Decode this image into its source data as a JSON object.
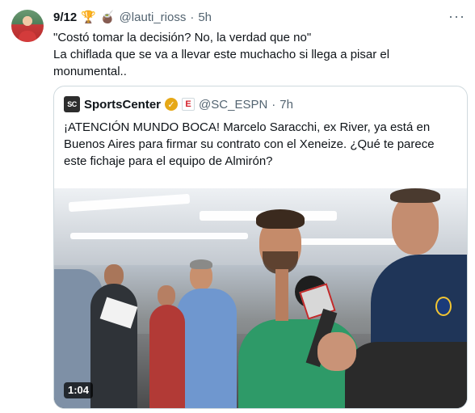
{
  "tweet": {
    "display_name": "9/12",
    "emoji_1": "🏆",
    "emoji_2": "🧉",
    "handle": "@lauti_rioss",
    "separator": "·",
    "time": "5h",
    "more_label": "···",
    "text_lines": [
      "\"Costó tomar la decisión? No, la verdad que no\"",
      "La chiflada que se va a llevar este muchacho si llega a pisar el",
      "monumental.."
    ]
  },
  "quote": {
    "logo_text": "SC",
    "display_name": "SportsCenter",
    "verified_mark": "✓",
    "affiliate_badge": "E",
    "handle": "@SC_ESPN",
    "separator": "·",
    "time": "7h",
    "text_lines": [
      "¡ATENCIÓN MUNDO BOCA! Marcelo Saracchi, ex River, ya está en",
      "Buenos Aires para firmar su contrato con el Xeneize. ¿Qué te parece",
      "este fichaje para el equipo de Almirón?"
    ],
    "video": {
      "duration": "1:04"
    }
  },
  "icons": {
    "avatar": "user-avatar",
    "verified": "gold-verified-badge-icon",
    "affiliate": "espn-affiliate-badge-icon",
    "more": "more-options-icon"
  },
  "colors": {
    "primary_text": "#0f1419",
    "secondary_text": "#536471",
    "border": "#cfd9de",
    "verified_gold": "#e6a817",
    "espn_red": "#d4202b"
  }
}
